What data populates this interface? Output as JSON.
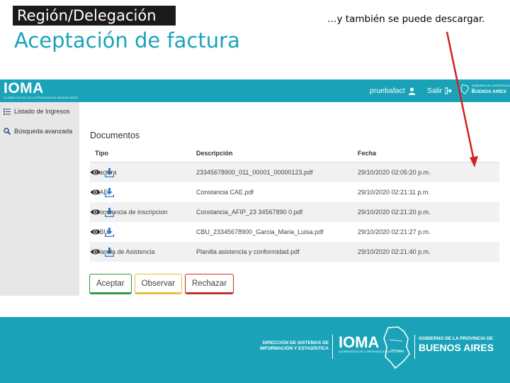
{
  "slide": {
    "region": "Región/Delegación",
    "title": "Aceptación de factura",
    "note": "…y también se puede descargar."
  },
  "colors": {
    "accent": "#1aa3b8",
    "download": "#2a7fd4",
    "arrow": "#d42020"
  },
  "header": {
    "logo": "IOMA",
    "logo_sub": "LA OBRA SOCIAL DE LA PROVINCIA DE BUENOS AIRES",
    "username": "pruebafact",
    "exit": "Salir",
    "gov_small": "GOBIERNO DE LA PROVINCIA DE",
    "gov_big": "BUENOS AIRES"
  },
  "sidebar": {
    "items": [
      {
        "label": "Listado de Ingresos",
        "icon": "list-icon"
      },
      {
        "label": "Búsqueda avanzada",
        "icon": "search-icon"
      }
    ]
  },
  "documents": {
    "title": "Documentos",
    "headers": [
      "Tipo",
      "Descripción",
      "Fecha"
    ],
    "rows": [
      {
        "tipo": "Factura",
        "descripcion": "23345678900_011_00001_00000123.pdf",
        "fecha": "29/10/2020 02:05:20 p.m."
      },
      {
        "tipo": "CAE",
        "descripcion": "Constancia CAE.pdf",
        "fecha": "29/10/2020 02:21:11 p.m."
      },
      {
        "tipo": "Constancia de inscripcion",
        "descripcion": "Constancia_AFIP_23 34567890 0.pdf",
        "fecha": "29/10/2020 02:21:20 p.m."
      },
      {
        "tipo": "CBU",
        "descripcion": "CBU_23345678900_Garcia_Maria_Luisa.pdf",
        "fecha": "29/10/2020 02:21:27 p.m."
      },
      {
        "tipo": "Planilla de Asistencia",
        "descripcion": "Planilla asistencia y conformidad.pdf",
        "fecha": "29/10/2020 02:21:40 p.m."
      }
    ]
  },
  "actions": {
    "accept": "Aceptar",
    "observe": "Observar",
    "reject": "Rechazar"
  },
  "footer": {
    "direccion_line1": "DIRECCIÓN DE SISTEMAS DE",
    "direccion_line2": "INFORMACIÓN Y ESTADÍSTICA",
    "ioma": "IOMA",
    "ioma_sub": "LA OBRA SOCIAL DE LA PROVINCIA DE BUENOS AIRES",
    "gov_small": "GOBIERNO DE LA PROVINCIA DE",
    "gov_big": "BUENOS AIRES"
  }
}
